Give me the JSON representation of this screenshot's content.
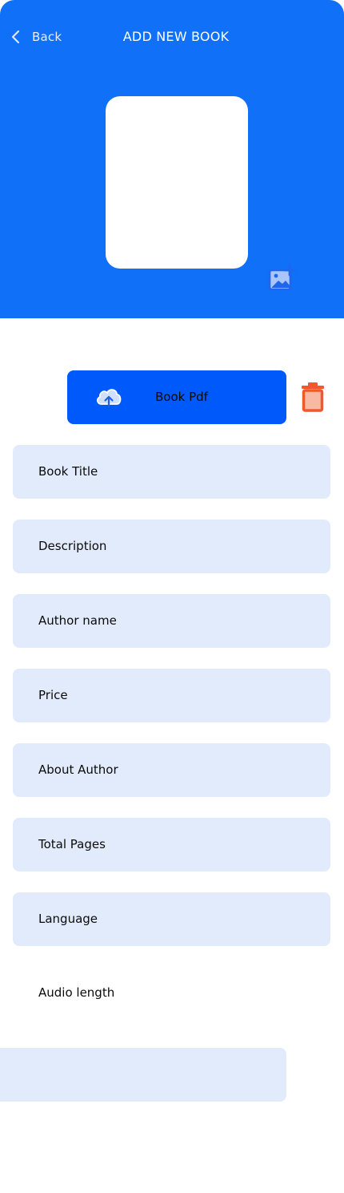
{
  "header": {
    "back_label": "Back",
    "title": "ADD NEW BOOK",
    "background_color": "#1070f8",
    "back_icon": "chevron-left-icon",
    "cover_icon": "add-image-icon"
  },
  "upload": {
    "pdf_label": "Book Pdf",
    "upload_icon": "cloud-upload-icon",
    "delete_icon": "trash-icon",
    "button_color": "#0059fa",
    "delete_color": "#f05a2b"
  },
  "form": {
    "fields": [
      {
        "label": "Book Title"
      },
      {
        "label": "Description"
      },
      {
        "label": "Author name"
      },
      {
        "label": "Price"
      },
      {
        "label": "About Author"
      },
      {
        "label": "Total Pages"
      },
      {
        "label": "Language"
      }
    ],
    "audio_label": "Audio length",
    "field_color": "#e2ebfb"
  }
}
